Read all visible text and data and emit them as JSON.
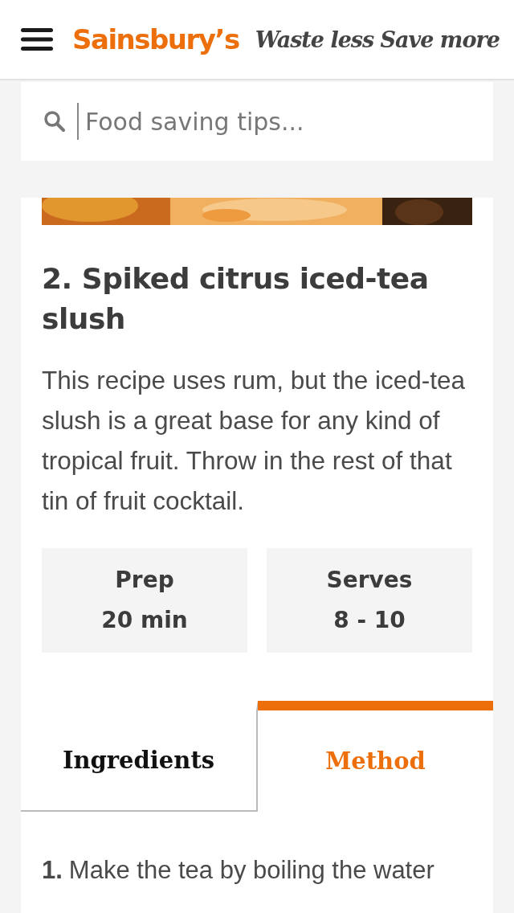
{
  "header": {
    "brand": "Sainsbury’s",
    "tagline": "Waste less Save more"
  },
  "search": {
    "placeholder": "Food saving tips..."
  },
  "recipe": {
    "title": "2. Spiked citrus iced-tea slush",
    "description": "This recipe uses rum, but the iced-tea slush is a great base for any kind of tropical fruit. Throw in the rest of that tin of fruit cocktail.",
    "facts": [
      {
        "label": "Prep",
        "value": "20 min"
      },
      {
        "label": "Serves",
        "value": "8 - 10"
      }
    ]
  },
  "tabs": [
    {
      "label": "Ingredients",
      "selected": false
    },
    {
      "label": "Method",
      "selected": true
    }
  ],
  "steps": [
    {
      "number": "1.",
      "text": "Make the tea by boiling the water"
    }
  ]
}
